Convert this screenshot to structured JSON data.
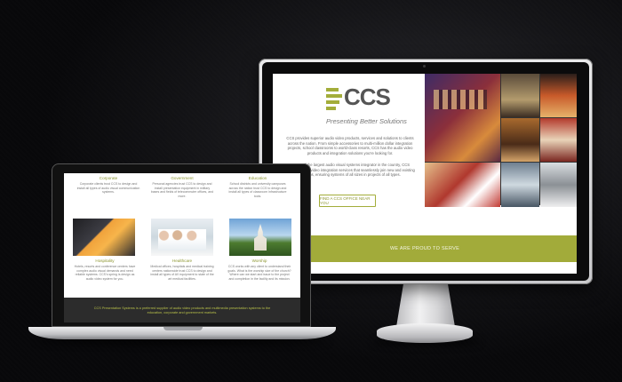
{
  "imac": {
    "logo_text": "CCS",
    "tagline": "Presenting Better Solutions",
    "intro_paragraphs": [
      "CCS provides superior audio video products, services and solutions to clients across the nation. From simple accessories to multi-million dollar integration projects, school classrooms to world-class resorts, CCS has the audio video products and integration solutions you're looking for.",
      "As one of the largest audio visual systems integrator in the country, CCS provides audio video integration services that seamlessly join new and existing systems, ensuring systems of all sizes in projects of all types."
    ],
    "find_button": "FIND A CCS OFFICE NEAR YOU",
    "proud_banner": "WE ARE PROUD TO SERVE"
  },
  "macbook": {
    "services_top": [
      {
        "title": "Corporate",
        "text": "Corporate clients trust CCS to design and install all types of audio visual communication systems."
      },
      {
        "title": "Government",
        "text": "Personal agencies trust CCS to design and install presentation equipment in military bases and fields of telecommuter offices, and more."
      },
      {
        "title": "Education",
        "text": "School districts and university campuses across the nation trust CCS to design and install all types of classroom infrastructure tools."
      }
    ],
    "services_bottom": [
      {
        "title": "Hospitality",
        "text": "Hotels, resorts and conference centers have complex audio visual demands and need reliable systems. CCS's spring is design as audio video system for you."
      },
      {
        "title": "Healthcare",
        "text": "Medical offices, hospitals and medical training centers nationwide trust CCS to design and install all types of AV equipment to state of the art medical facilities."
      },
      {
        "title": "Worship",
        "text": "CCS works with any client to understand their goals. What is the worship size of the church? Where can we start and issue to the project and completion in the facility and its mission."
      }
    ],
    "footer_text": "CCS Presentation Systems is a preferred supplier of audio video products and multimedia presentation systems to the education, corporate and government markets."
  }
}
